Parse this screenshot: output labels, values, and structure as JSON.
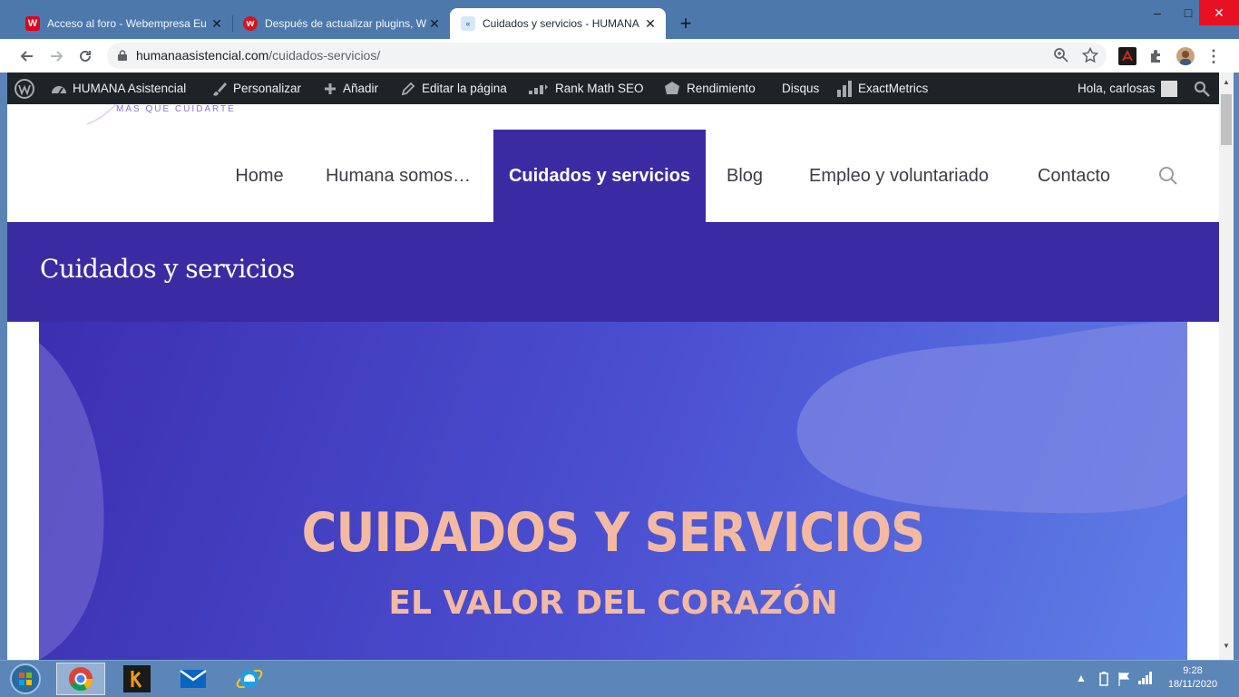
{
  "browser": {
    "tabs": [
      {
        "title": "Acceso al foro - Webempresa Eu",
        "favicon": "webempresa-icon",
        "active": false
      },
      {
        "title": "Después de actualizar plugins, W",
        "favicon": "webempresa-round-icon",
        "active": false
      },
      {
        "title": "Cuidados y servicios - HUMANA",
        "favicon": "site-favicon-icon",
        "active": true
      }
    ],
    "new_tab_label": "+",
    "url_host": "humanaasistencial.com",
    "url_path": "/cuidados-servicios/",
    "window_controls": {
      "minimize": "–",
      "maximize": "□",
      "close": "✕"
    }
  },
  "admin_bar": {
    "items": [
      {
        "label": "",
        "icon": "wordpress-icon"
      },
      {
        "label": "HUMANA Asistencial",
        "icon": "dashboard-icon"
      },
      {
        "label": "Personalizar",
        "icon": "brush-icon"
      },
      {
        "label": "Añadir",
        "icon": "plus-icon"
      },
      {
        "label": "Editar la página",
        "icon": "pencil-icon"
      },
      {
        "label": "Rank Math SEO",
        "icon": "rank-math-icon"
      },
      {
        "label": "Rendimiento",
        "icon": "performance-icon"
      },
      {
        "label": "Disqus",
        "icon": ""
      },
      {
        "label": "ExactMetrics",
        "icon": "bar-chart-icon"
      }
    ],
    "greeting": "Hola, carlosas"
  },
  "site": {
    "tagline": "MÁS QUE CUIDARTE",
    "nav": [
      {
        "label": "Home",
        "current": false
      },
      {
        "label": "Humana somos…",
        "current": false
      },
      {
        "label": "Cuidados y servicios",
        "current": true
      },
      {
        "label": "Blog",
        "current": false
      },
      {
        "label": "Empleo y voluntariado",
        "current": false
      },
      {
        "label": "Contacto",
        "current": false
      }
    ],
    "page_title": "Cuidados y servicios",
    "hero": {
      "title": "CUIDADOS Y SERVICIOS",
      "subtitle": "EL VALOR DEL CORAZÓN"
    }
  },
  "taskbar": {
    "time": "9:28",
    "date": "18/11/2020"
  },
  "colors": {
    "brand_purple": "#3b2ba2",
    "hero_text": "#f3b9a2",
    "admin_bar": "#1d2327"
  }
}
